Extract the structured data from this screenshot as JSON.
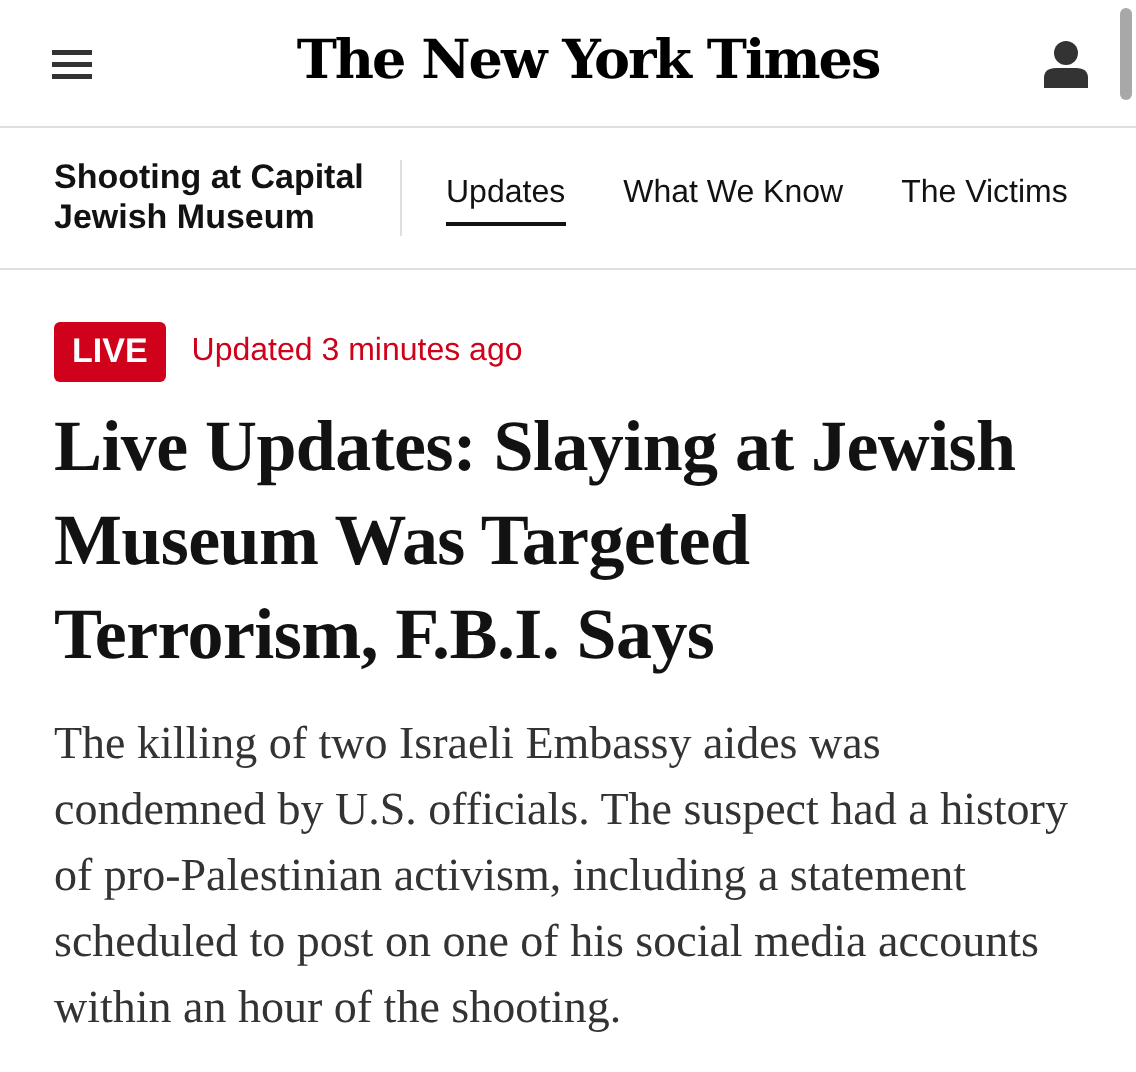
{
  "masthead": {
    "logo": "The New York Times"
  },
  "story_nav": {
    "title": "Shooting at Capital Jewish Museum",
    "tabs": [
      {
        "label": "Updates",
        "selected": true
      },
      {
        "label": "What We Know",
        "selected": false
      },
      {
        "label": "The Victims",
        "selected": false
      }
    ]
  },
  "article": {
    "badge": "LIVE",
    "updated": "Updated 3 minutes ago",
    "headline": "Live Updates: Slaying at Jewish Museum Was Targeted Terrorism, F.B.I. Says",
    "summary": "The killing of two Israeli Embassy aides was condemned by U.S. officials. The suspect had a history of pro-Palestinian activism, including a statement scheduled to post on one of his social media accounts within an hour of the shooting."
  }
}
